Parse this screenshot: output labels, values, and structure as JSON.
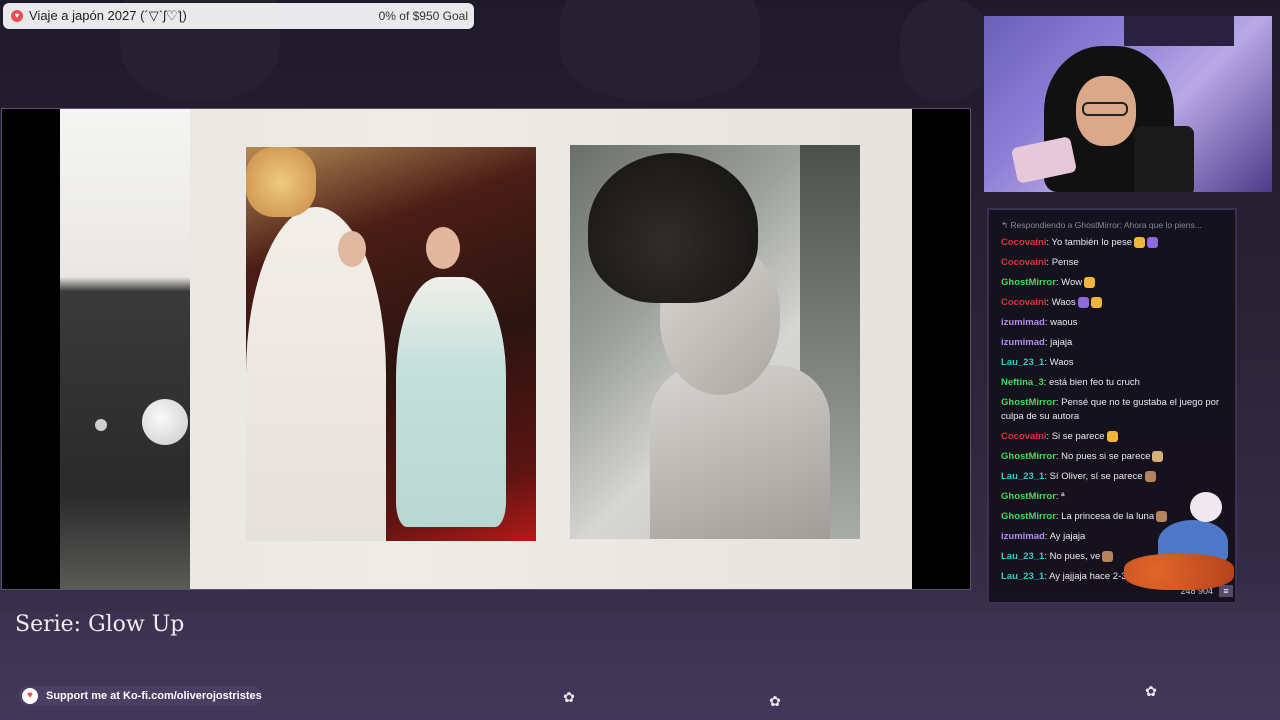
{
  "goal": {
    "title": "Viaje a japón 2027 (´▽`ʃ♡ƪ)",
    "progress_text": "0% of $950 Goal",
    "progress_fraction": 0.0,
    "accent": "#e94e4e"
  },
  "stream": {
    "caption": "Serie: Glow Up"
  },
  "support": {
    "text": "Support me at Ko-fi.com/oliverojostristes",
    "icon": "kofi-heart-icon"
  },
  "chat": {
    "reply_context": "Respondiendo a GhostMirror: Ahora que lo piens...",
    "messages": [
      {
        "user": "Cocovaini",
        "color": "#e0323a",
        "text": "Yo también lo pese",
        "emotes": [
          "gold",
          "purple"
        ]
      },
      {
        "user": "Cocovaini",
        "color": "#e0323a",
        "text": "Pense",
        "emotes": []
      },
      {
        "user": "GhostMirror",
        "color": "#3ddc5c",
        "text": "Wow",
        "emotes": [
          "gold"
        ]
      },
      {
        "user": "Cocovaini",
        "color": "#e0323a",
        "text": "Waos",
        "emotes": [
          "purple",
          "gold"
        ]
      },
      {
        "user": "izumimad",
        "color": "#b58cf0",
        "text": "waous",
        "emotes": []
      },
      {
        "user": "izumimad",
        "color": "#b58cf0",
        "text": "jajaja",
        "emotes": []
      },
      {
        "user": "Lau_23_1",
        "color": "#39c9c4",
        "text": "Waos",
        "emotes": []
      },
      {
        "user": "Neftina_3",
        "color": "#3ddc5c",
        "text": "está bien feo tu cruch",
        "emotes": []
      },
      {
        "user": "GhostMirror",
        "color": "#3ddc5c",
        "text": "Pensé que no te gustaba el juego por culpa de su autora",
        "emotes": []
      },
      {
        "user": "Cocovaini",
        "color": "#e0323a",
        "text": "Si se parece",
        "emotes": [
          "gold"
        ]
      },
      {
        "user": "GhostMirror",
        "color": "#3ddc5c",
        "text": "No pues si se parece",
        "emotes": [
          "tan"
        ]
      },
      {
        "user": "Lau_23_1",
        "color": "#39c9c4",
        "text": "Sí Oliver, sí se parece",
        "emotes": [
          "face"
        ]
      },
      {
        "user": "GhostMirror",
        "color": "#3ddc5c",
        "text": "ª",
        "emotes": []
      },
      {
        "user": "GhostMirror",
        "color": "#3ddc5c",
        "text": "La princesa de la luna",
        "emotes": [
          "face"
        ]
      },
      {
        "user": "izumimad",
        "color": "#b58cf0",
        "text": "Ay jajaja",
        "emotes": []
      },
      {
        "user": "Lau_23_1",
        "color": "#39c9c4",
        "text": "No pues, ve",
        "emotes": [
          "face"
        ]
      },
      {
        "user": "Lau_23_1",
        "color": "#39c9c4",
        "text": "Ay jajjaja hace 2-3 años",
        "emotes": []
      }
    ],
    "viewer_count": "248 904",
    "menu_icon": "hamburger-menu-icon"
  }
}
